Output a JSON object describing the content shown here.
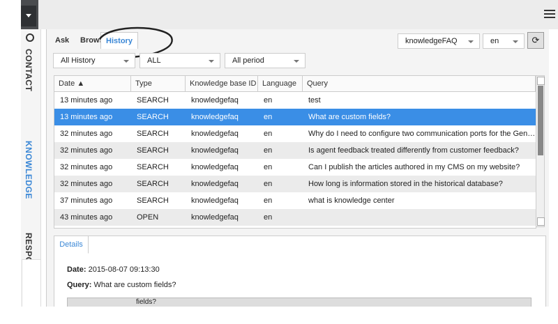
{
  "header": {
    "menu_icon": "hamburger-icon"
  },
  "sidebar": {
    "items": [
      {
        "label": "CONTACT",
        "icon": "circle-icon"
      },
      {
        "label": "KNOWLEDGE"
      },
      {
        "label": "RESPONSES"
      }
    ]
  },
  "tabs": [
    {
      "label": "Ask"
    },
    {
      "label": "Browse"
    },
    {
      "label": "History"
    }
  ],
  "selectors": {
    "knowledge_base": "knowledgeFAQ",
    "language": "en"
  },
  "filters": {
    "history": "All History",
    "type": "ALL",
    "period": "All period"
  },
  "grid": {
    "columns": [
      "Date",
      "Type",
      "Knowledge base ID",
      "Language",
      "Query"
    ],
    "rows": [
      [
        "13 minutes ago",
        "SEARCH",
        "knowledgefaq",
        "en",
        "test"
      ],
      [
        "13 minutes ago",
        "SEARCH",
        "knowledgefaq",
        "en",
        "What are custom fields?"
      ],
      [
        "32 minutes ago",
        "SEARCH",
        "knowledgefaq",
        "en",
        "Why do I need to configure two communication ports for the Genesys Kno..."
      ],
      [
        "32 minutes ago",
        "SEARCH",
        "knowledgefaq",
        "en",
        "Is agent feedback treated differently from customer feedback?"
      ],
      [
        "32 minutes ago",
        "SEARCH",
        "knowledgefaq",
        "en",
        "Can I publish the articles authored in my CMS on my website?"
      ],
      [
        "32 minutes ago",
        "SEARCH",
        "knowledgefaq",
        "en",
        "How long is information stored in the historical database?"
      ],
      [
        "37 minutes ago",
        "SEARCH",
        "knowledgefaq",
        "en",
        "what is knowledge center"
      ],
      [
        "43 minutes ago",
        "OPEN",
        "knowledgefaq",
        "en",
        ""
      ]
    ],
    "selected_row": 1
  },
  "details": {
    "tab_label": "Details",
    "date_label": "Date:",
    "date_value": "2015-08-07 09:13:30",
    "query_label": "Query:",
    "query_value": "What are custom fields?",
    "box_text": "fields?"
  },
  "colors": {
    "accent": "#3a87d6",
    "selected_row": "#3a8ee6"
  }
}
